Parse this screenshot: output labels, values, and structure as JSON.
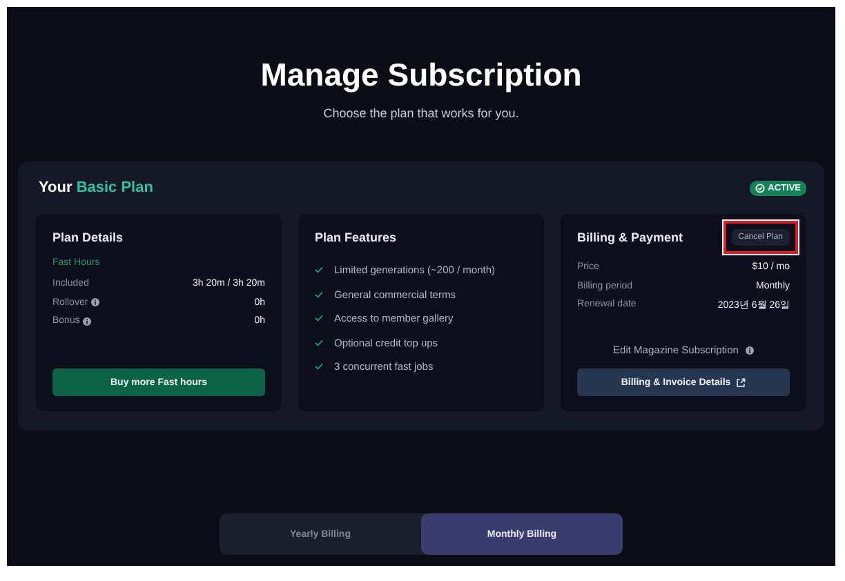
{
  "title": "Manage Subscription",
  "subtitle": "Choose the plan that works for you.",
  "plan": {
    "prefix": "Your",
    "name": "Basic Plan",
    "status": "ACTIVE"
  },
  "details": {
    "heading": "Plan Details",
    "section": "Fast Hours",
    "rows": [
      {
        "label": "Included",
        "value": "3h 20m / 3h 20m",
        "info": false
      },
      {
        "label": "Rollover",
        "value": "0h",
        "info": true
      },
      {
        "label": "Bonus",
        "value": "0h",
        "info": true
      }
    ],
    "button": "Buy more Fast hours"
  },
  "features": {
    "heading": "Plan Features",
    "items": [
      "Limited generations (~200 / month)",
      "General commercial terms",
      "Access to member gallery",
      "Optional credit top ups",
      "3 concurrent fast jobs"
    ]
  },
  "billing": {
    "heading": "Billing & Payment",
    "cancel_button": "Cancel Plan",
    "cancel_highlighted": true,
    "rows": [
      {
        "label": "Price",
        "value": "$10 / mo"
      },
      {
        "label": "Billing period",
        "value": "Monthly"
      },
      {
        "label": "Renewal date",
        "value": "2023년 6월 26일"
      }
    ],
    "edit_link": "Edit Magazine Subscription",
    "details_button": "Billing & Invoice Details"
  },
  "billing_tabs": [
    {
      "label": "Yearly Billing",
      "selected": false
    },
    {
      "label": "Monthly Billing",
      "selected": true
    }
  ]
}
